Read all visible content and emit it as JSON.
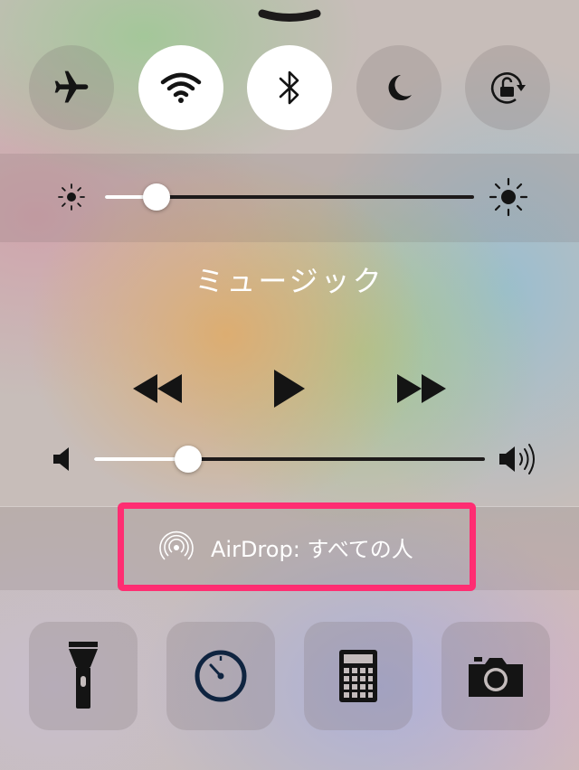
{
  "handle": {
    "icon": "chevron-down-icon"
  },
  "toggles": [
    {
      "id": "airplane",
      "icon": "airplane-icon",
      "on": false
    },
    {
      "id": "wifi",
      "icon": "wifi-icon",
      "on": true
    },
    {
      "id": "bluetooth",
      "icon": "bluetooth-icon",
      "on": true
    },
    {
      "id": "do-not-disturb",
      "icon": "moon-icon",
      "on": false
    },
    {
      "id": "rotation-lock",
      "icon": "rotation-lock-icon",
      "on": false
    }
  ],
  "brightness": {
    "value": 0.14,
    "min_icon": "sun-small-icon",
    "max_icon": "sun-large-icon"
  },
  "music": {
    "title": "ミュージック",
    "controls": [
      "rewind-icon",
      "play-icon",
      "fast-forward-icon"
    ]
  },
  "volume": {
    "value": 0.24,
    "min_icon": "speaker-icon",
    "max_icon": "speaker-loud-icon"
  },
  "airdrop": {
    "label": "AirDrop: すべての人",
    "icon": "airdrop-icon",
    "highlight_color": "#ff2d72"
  },
  "shortcuts": [
    {
      "id": "flashlight",
      "icon": "flashlight-icon"
    },
    {
      "id": "timer",
      "icon": "timer-icon"
    },
    {
      "id": "calculator",
      "icon": "calculator-icon"
    },
    {
      "id": "camera",
      "icon": "camera-icon"
    }
  ],
  "colors": {
    "icon_dark": "#141414",
    "timer_icon": "#0f2440",
    "highlight": "#ff2d72"
  }
}
